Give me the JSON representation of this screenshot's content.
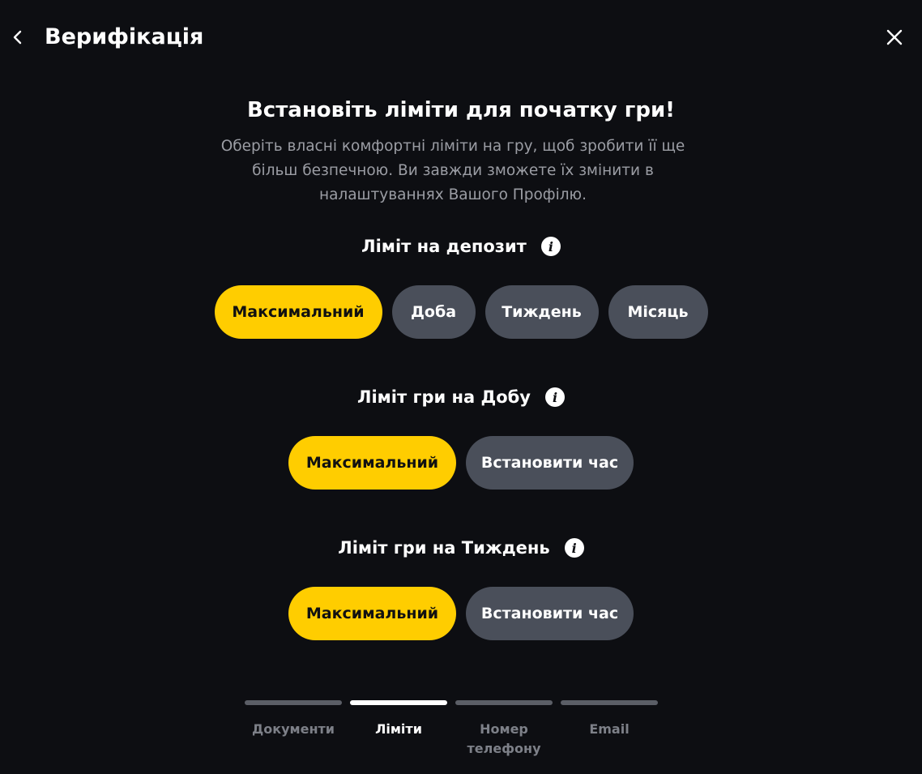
{
  "header": {
    "title": "Верифікація",
    "back_icon": "chevron-left-icon",
    "close_icon": "close-icon"
  },
  "intro": {
    "heading": "Встановіть ліміти для початку гри!",
    "subtitle": "Оберіть власні комфортні ліміти на гру, щоб зробити її ще більш безпечною. Ви завжди зможете їх змінити в налаштуваннях Вашого Профілю."
  },
  "deposit_limit": {
    "title": "Ліміт на депозит",
    "options": [
      "Максимальний",
      "Доба",
      "Тиждень",
      "Місяць"
    ],
    "selected": "Максимальний"
  },
  "daily_game_limit": {
    "title": "Ліміт гри на Добу",
    "options": [
      "Максимальний",
      "Встановити час"
    ],
    "selected": "Максимальний"
  },
  "weekly_game_limit": {
    "title": "Ліміт гри на Тиждень",
    "options": [
      "Максимальний",
      "Встановити час"
    ],
    "selected": "Максимальний"
  },
  "stepper": {
    "steps": [
      "Документи",
      "Ліміти",
      "Номер телефону",
      "Email"
    ],
    "active_step": "Ліміти"
  },
  "colors": {
    "background": "#0d0e12",
    "accent": "#ffcd00",
    "pill_inactive": "#4a4f5a",
    "muted_text": "#9b9da4"
  }
}
